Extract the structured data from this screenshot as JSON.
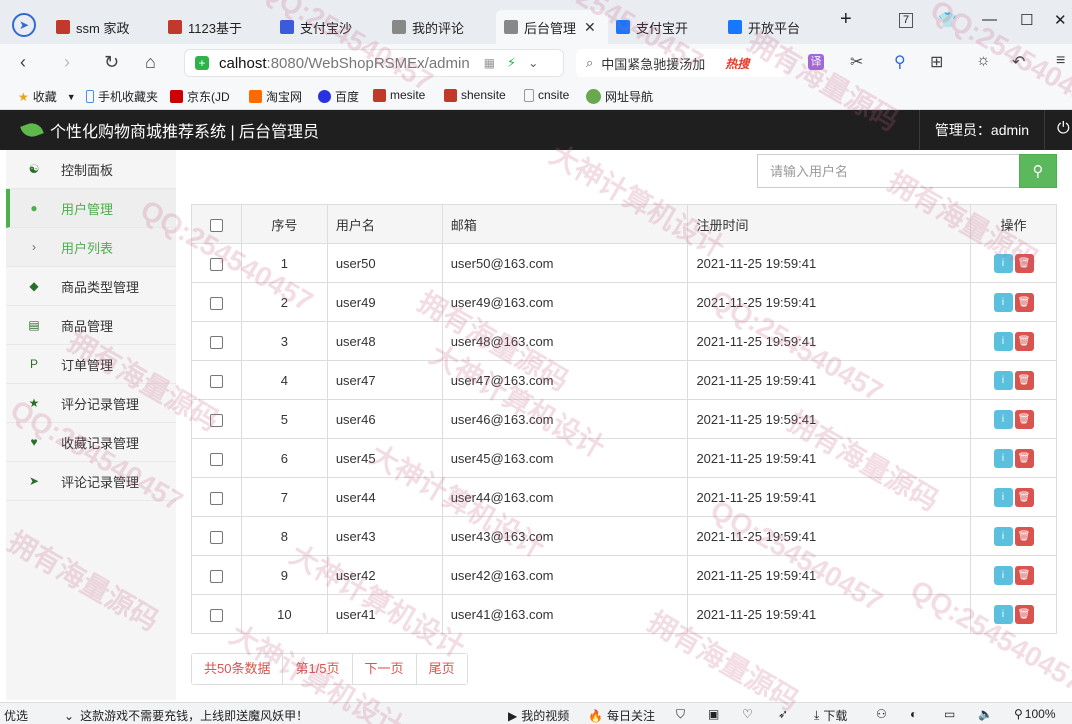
{
  "browser": {
    "tabs": [
      {
        "label": "ssm 家政",
        "color": "#c0392b"
      },
      {
        "label": "1123基于",
        "color": "#c0392b"
      },
      {
        "label": "支付宝沙",
        "color": "#3b5bdb"
      },
      {
        "label": "我的评论",
        "color": "#888888"
      },
      {
        "label": "后台管理",
        "color": "#888888"
      },
      {
        "label": "支付宝开",
        "color": "#1677ff"
      },
      {
        "label": "开放平台",
        "color": "#1677ff"
      }
    ],
    "new_tab": "+",
    "badge_count": "7",
    "url_host": "calhost",
    "url_rest": ":8080/WebShopRSMEx/admin",
    "search_text": "中国紧急驰援汤加",
    "search_hot": "热搜",
    "bookmarks": [
      "收藏",
      "手机收藏夹",
      "京东(JD",
      "淘宝网",
      "百度",
      "mesite",
      "shensite",
      "cnsite",
      "网址导航"
    ]
  },
  "header": {
    "title": "个性化购物商城推荐系统 | 后台管理员",
    "admin_label": "管理员：admin"
  },
  "sidebar": {
    "items": [
      {
        "label": "控制面板",
        "icon": "dashboard-icon",
        "glyph": "☯"
      },
      {
        "label": "用户管理",
        "icon": "user-icon",
        "glyph": "●"
      },
      {
        "label": "用户列表",
        "icon": "chevron-right-icon",
        "glyph": "›"
      },
      {
        "label": "商品类型管理",
        "icon": "tags-icon",
        "glyph": "◆"
      },
      {
        "label": "商品管理",
        "icon": "card-icon",
        "glyph": "▤"
      },
      {
        "label": "订单管理",
        "icon": "paypal-icon",
        "glyph": "P"
      },
      {
        "label": "评分记录管理",
        "icon": "star-icon",
        "glyph": "★"
      },
      {
        "label": "收藏记录管理",
        "icon": "heart-icon",
        "glyph": "♥"
      },
      {
        "label": "评论记录管理",
        "icon": "send-icon",
        "glyph": "➤"
      }
    ]
  },
  "search": {
    "placeholder": "请输入用户名"
  },
  "table": {
    "headers": [
      "序号",
      "用户名",
      "邮箱",
      "注册时间",
      "操作"
    ],
    "rows": [
      [
        "1",
        "user50",
        "user50@163.com",
        "2021-11-25 19:59:41"
      ],
      [
        "2",
        "user49",
        "user49@163.com",
        "2021-11-25 19:59:41"
      ],
      [
        "3",
        "user48",
        "user48@163.com",
        "2021-11-25 19:59:41"
      ],
      [
        "4",
        "user47",
        "user47@163.com",
        "2021-11-25 19:59:41"
      ],
      [
        "5",
        "user46",
        "user46@163.com",
        "2021-11-25 19:59:41"
      ],
      [
        "6",
        "user45",
        "user45@163.com",
        "2021-11-25 19:59:41"
      ],
      [
        "7",
        "user44",
        "user44@163.com",
        "2021-11-25 19:59:41"
      ],
      [
        "8",
        "user43",
        "user43@163.com",
        "2021-11-25 19:59:41"
      ],
      [
        "9",
        "user42",
        "user42@163.com",
        "2021-11-25 19:59:41"
      ],
      [
        "10",
        "user41",
        "user41@163.com",
        "2021-11-25 19:59:41"
      ]
    ]
  },
  "pager": {
    "total": "共50条数据",
    "page": "第1/5页",
    "next": "下一页",
    "last": "尾页"
  },
  "statusbar": {
    "left1": "优选",
    "left2": "这款游戏不需要充钱，上线即送魔风妖甲！",
    "video": "我的视频",
    "daily": "每日关注",
    "download": "下载",
    "zoom": "100%"
  },
  "watermark": [
    "QQ:254540457",
    "拥有海量源码",
    "大神计算机设计"
  ],
  "colors": {
    "accent": "#5cb85c",
    "danger": "#d9534f",
    "info": "#5bc0de",
    "header_bg": "#1f1f1f"
  }
}
